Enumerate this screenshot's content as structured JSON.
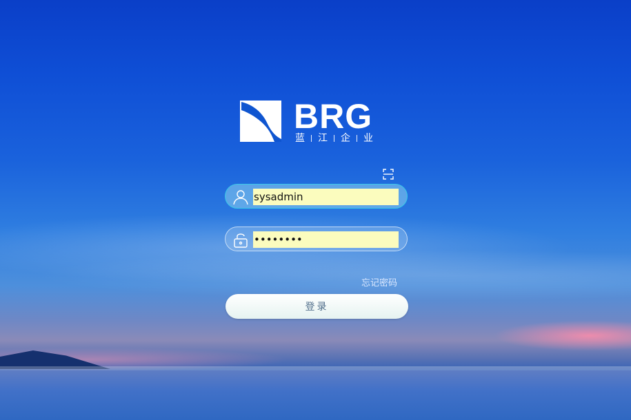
{
  "brand": {
    "logo_text": "BRG",
    "tagline": [
      "蓝",
      "江",
      "企",
      "业"
    ]
  },
  "login": {
    "username_value": "sysadmin",
    "password_value": "........",
    "forgot_label": "忘记密码",
    "submit_label": "登录"
  },
  "icons": {
    "scan": "scan-icon",
    "user": "user-icon",
    "lock": "lock-icon"
  },
  "colors": {
    "field_focus_border": "#38c7e8",
    "autofill_bg": "#fbfcbe"
  }
}
